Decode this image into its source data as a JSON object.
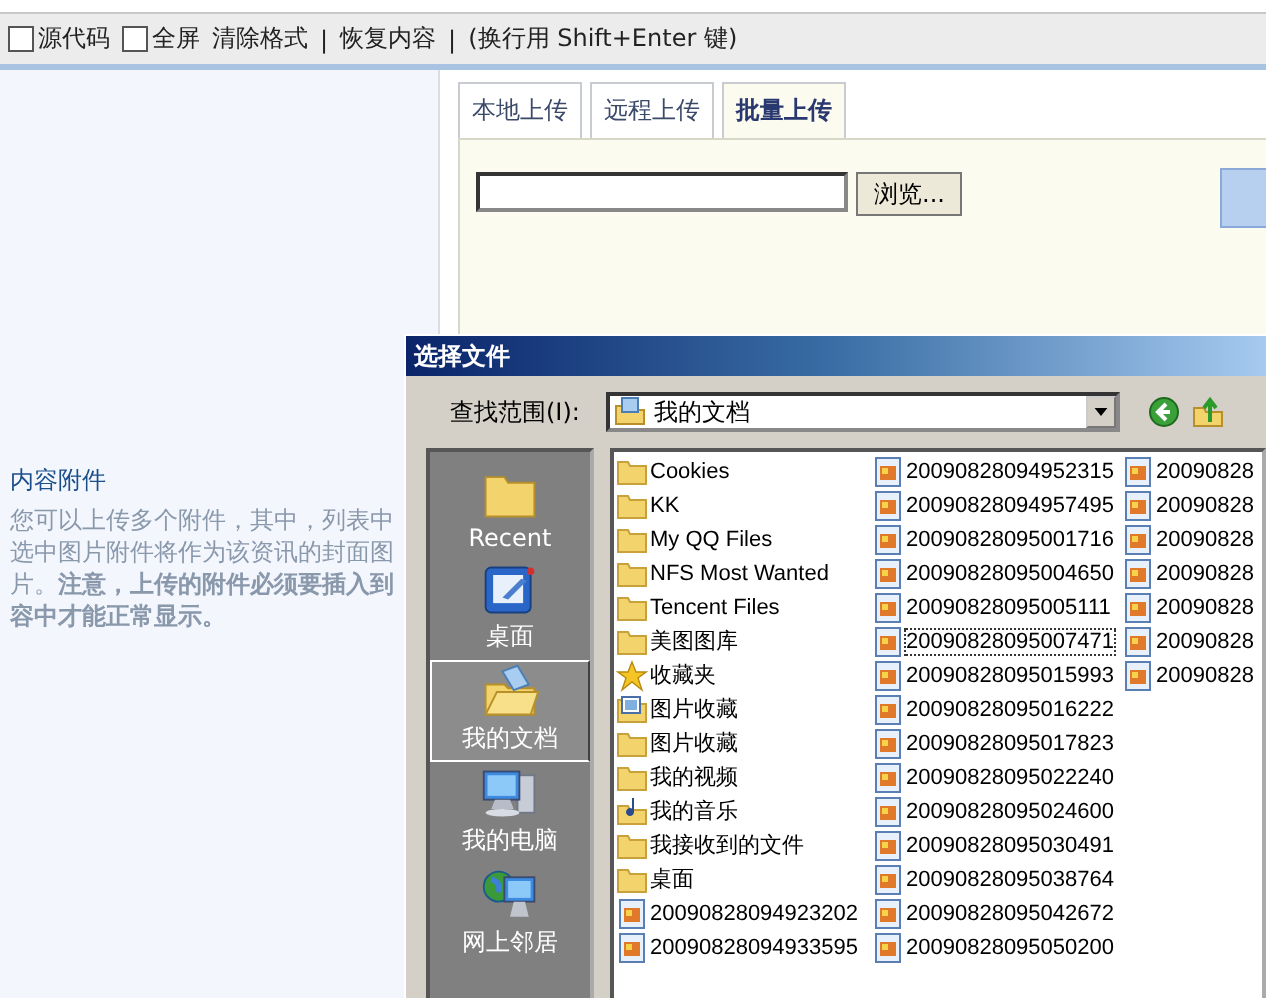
{
  "toolbar": {
    "items": [
      {
        "kind": "checkbox",
        "label": "源代码",
        "checked": false
      },
      {
        "kind": "checkbox",
        "label": "全屏",
        "checked": false
      },
      {
        "kind": "link",
        "label": "清除格式"
      },
      {
        "kind": "separator",
        "label": "|"
      },
      {
        "kind": "link",
        "label": "恢复内容"
      },
      {
        "kind": "separator",
        "label": "|"
      },
      {
        "kind": "text",
        "label": "(换行用  Shift+Enter 键)"
      }
    ]
  },
  "attachments": {
    "title": "内容附件",
    "lines": [
      "您可以上传多个附件，其中，列表中",
      "选中图片附件将作为该资讯的封面图",
      "片。**注意，上传的附件必须要插入到**",
      "**容中才能正常显示。**"
    ]
  },
  "upload": {
    "tabs": [
      {
        "label": "本地上传",
        "selected": false
      },
      {
        "label": "远程上传",
        "selected": false
      },
      {
        "label": "批量上传",
        "selected": true
      }
    ],
    "browse_button": "浏览..."
  },
  "dialog": {
    "title": "选择文件",
    "look_in_label": "查找范围(I):",
    "look_in": "我的文档",
    "places": [
      {
        "kind": "recent",
        "label": "Recent",
        "selected": false
      },
      {
        "kind": "desktop",
        "label": "桌面",
        "selected": false
      },
      {
        "kind": "documents",
        "label": "我的文档",
        "selected": true
      },
      {
        "kind": "computer",
        "label": "我的电脑",
        "selected": false
      },
      {
        "kind": "network",
        "label": "网上邻居",
        "selected": false
      }
    ],
    "files": [
      {
        "name": "Cookies",
        "kind": "folder",
        "focused": false
      },
      {
        "name": "KK",
        "kind": "folder",
        "focused": false
      },
      {
        "name": "My QQ Files",
        "kind": "folder",
        "focused": false
      },
      {
        "name": "NFS Most Wanted",
        "kind": "folder",
        "focused": false
      },
      {
        "name": "Tencent Files",
        "kind": "folder",
        "focused": false
      },
      {
        "name": "美图图库",
        "kind": "folder",
        "focused": false
      },
      {
        "name": "收藏夹",
        "kind": "favorites",
        "focused": false
      },
      {
        "name": "图片收藏",
        "kind": "pictures",
        "focused": false
      },
      {
        "name": "图片收藏",
        "kind": "folder",
        "focused": false
      },
      {
        "name": "我的视频",
        "kind": "folder",
        "focused": false
      },
      {
        "name": "我的音乐",
        "kind": "music",
        "focused": false
      },
      {
        "name": "我接收到的文件",
        "kind": "folder",
        "focused": false
      },
      {
        "name": "桌面",
        "kind": "folder",
        "focused": false
      },
      {
        "name": "20090828094923202",
        "kind": "image",
        "focused": false
      },
      {
        "name": "20090828094933595",
        "kind": "image",
        "focused": false
      },
      {
        "name": "20090828094952315",
        "kind": "image",
        "focused": false
      },
      {
        "name": "20090828094957495",
        "kind": "image",
        "focused": false
      },
      {
        "name": "20090828095001716",
        "kind": "image",
        "focused": false
      },
      {
        "name": "20090828095004650",
        "kind": "image",
        "focused": false
      },
      {
        "name": "20090828095005111",
        "kind": "image",
        "focused": false
      },
      {
        "name": "20090828095007471",
        "kind": "image",
        "focused": true
      },
      {
        "name": "20090828095015993",
        "kind": "image",
        "focused": false
      },
      {
        "name": "20090828095016222",
        "kind": "image",
        "focused": false
      },
      {
        "name": "20090828095017823",
        "kind": "image",
        "focused": false
      },
      {
        "name": "20090828095022240",
        "kind": "image",
        "focused": false
      },
      {
        "name": "20090828095024600",
        "kind": "image",
        "focused": false
      },
      {
        "name": "20090828095030491",
        "kind": "image",
        "focused": false
      },
      {
        "name": "20090828095038764",
        "kind": "image",
        "focused": false
      },
      {
        "name": "20090828095042672",
        "kind": "image",
        "focused": false
      },
      {
        "name": "20090828095050200",
        "kind": "image",
        "focused": false
      },
      {
        "name": "20090828",
        "kind": "image",
        "focused": false
      },
      {
        "name": "20090828",
        "kind": "image",
        "focused": false
      },
      {
        "name": "20090828",
        "kind": "image",
        "focused": false
      },
      {
        "name": "20090828",
        "kind": "image",
        "focused": false
      },
      {
        "name": "20090828",
        "kind": "image",
        "focused": false
      },
      {
        "name": "20090828",
        "kind": "image",
        "focused": false
      },
      {
        "name": "20090828",
        "kind": "image",
        "focused": false
      }
    ]
  }
}
